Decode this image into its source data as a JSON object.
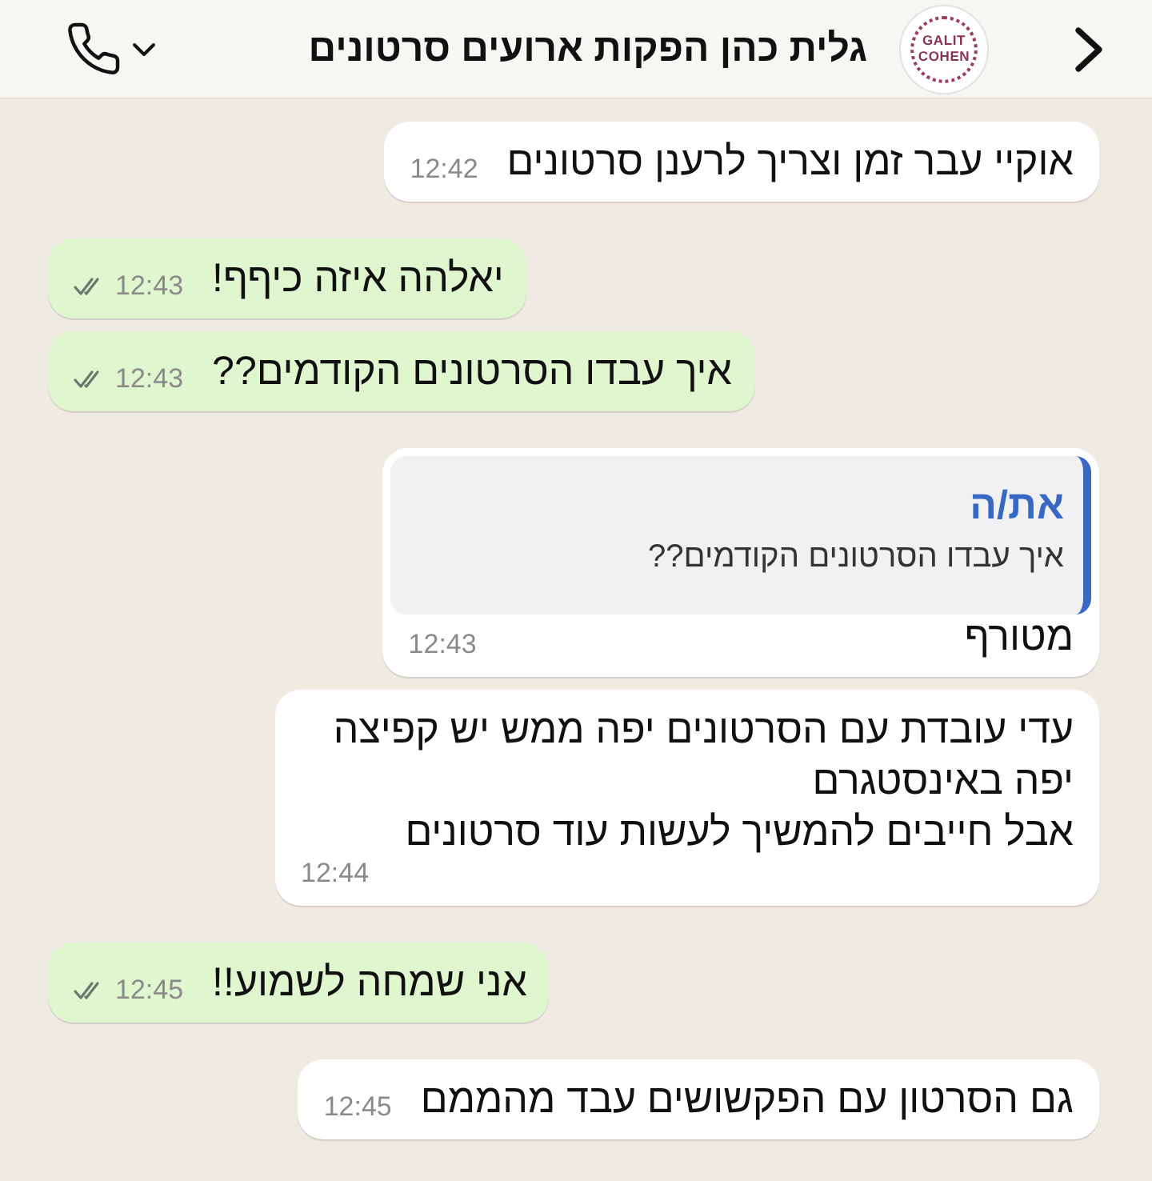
{
  "header": {
    "title": "גלית כהן הפקות ארועים סרטונים",
    "avatar": {
      "logo_text": "GALIT\nCOHEN"
    }
  },
  "messages": [
    {
      "kind": "incoming",
      "text": "אוקיי עבר זמן וצריך לרענן סרטונים",
      "time": "12:42"
    },
    {
      "kind": "outgoing",
      "text": "יאלהה איזה כיףף!",
      "time": "12:43",
      "read": false
    },
    {
      "kind": "outgoing",
      "text": "איך עבדו הסרטונים הקודמים??",
      "time": "12:43",
      "read": false
    },
    {
      "kind": "incoming",
      "reply_to": {
        "sender": "את/ה",
        "text": "איך עבדו הסרטונים הקודמים??"
      },
      "text": "מטורף",
      "time": "12:43"
    },
    {
      "kind": "incoming",
      "text": "עדי עובדת עם הסרטונים יפה ממש יש קפיצה\nיפה באינסטגרם\nאבל חייבים להמשיך לעשות עוד סרטונים",
      "time": "12:44"
    },
    {
      "kind": "outgoing",
      "text": "אני שמחה לשמוע!!",
      "time": "12:45",
      "read": false
    },
    {
      "kind": "incoming",
      "text": "גם הסרטון עם הפקשושים עבד מהממם",
      "time": "12:45"
    }
  ]
}
